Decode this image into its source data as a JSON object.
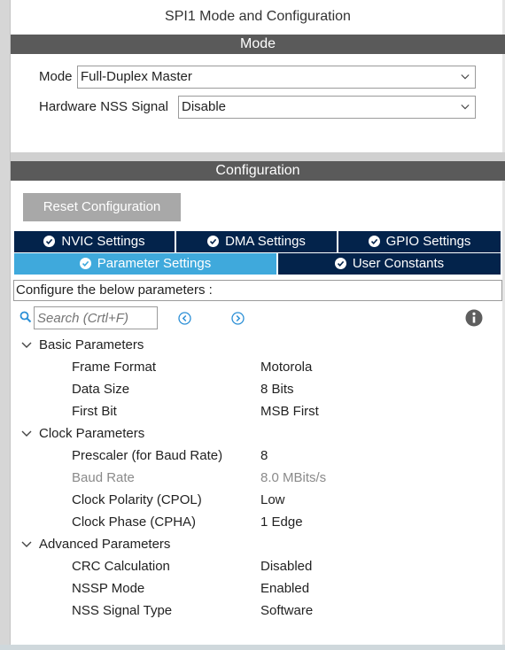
{
  "title": "SPI1 Mode and Configuration",
  "mode_section": {
    "header": "Mode",
    "mode_label": "Mode",
    "mode_value": "Full-Duplex Master",
    "nss_label": "Hardware NSS Signal",
    "nss_value": "Disable"
  },
  "config_section": {
    "header": "Configuration",
    "reset_button": "Reset Configuration"
  },
  "tabs": {
    "nvic": "NVIC Settings",
    "dma": "DMA Settings",
    "gpio": "GPIO Settings",
    "parameter": "Parameter Settings",
    "user_constants": "User Constants"
  },
  "info_text": "Configure the below parameters :",
  "search": {
    "placeholder": "Search (Crtl+F)"
  },
  "groups": {
    "basic": {
      "label": "Basic Parameters",
      "params": [
        {
          "name": "Frame Format",
          "value": "Motorola"
        },
        {
          "name": "Data Size",
          "value": "8 Bits"
        },
        {
          "name": "First Bit",
          "value": "MSB First"
        }
      ]
    },
    "clock": {
      "label": "Clock Parameters",
      "params": [
        {
          "name": "Prescaler (for Baud Rate)",
          "value": "8"
        },
        {
          "name": "Baud Rate",
          "value": "8.0 MBits/s"
        },
        {
          "name": "Clock Polarity (CPOL)",
          "value": "Low"
        },
        {
          "name": "Clock Phase (CPHA)",
          "value": "1 Edge"
        }
      ]
    },
    "advanced": {
      "label": "Advanced Parameters",
      "params": [
        {
          "name": "CRC Calculation",
          "value": "Disabled"
        },
        {
          "name": "NSSP Mode",
          "value": "Enabled"
        },
        {
          "name": "NSS Signal Type",
          "value": "Software"
        }
      ]
    }
  },
  "colors": {
    "section_bar": "#5a5a5a",
    "tab_dark": "#03234b",
    "tab_active": "#3fa9dc",
    "link_blue": "#2b8fd6"
  },
  "icons": [
    "chevron-down-icon",
    "check-circle-icon",
    "search-icon",
    "arrow-left-icon",
    "arrow-right-icon",
    "info-icon"
  ]
}
